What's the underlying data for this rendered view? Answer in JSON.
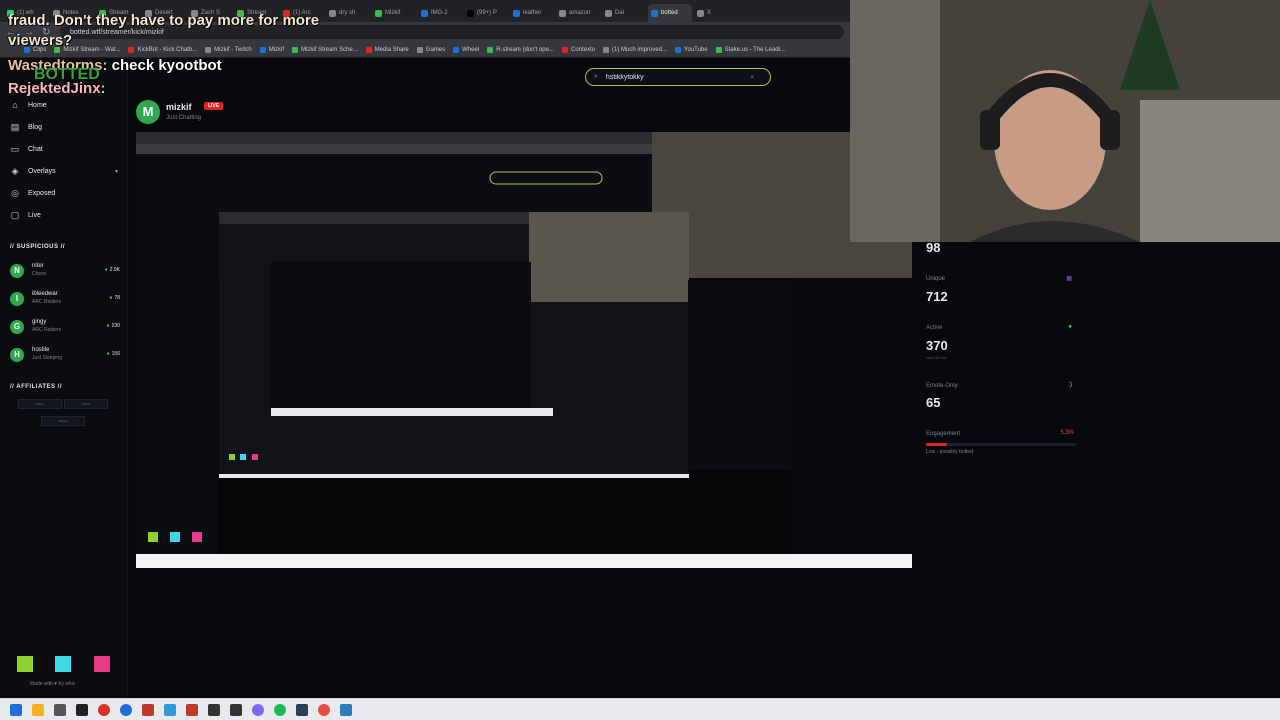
{
  "browser": {
    "tabs": [
      "(1) wh",
      "Notes",
      "Stream",
      "Desert",
      "Zach S",
      "Stream",
      "(1) Arc",
      "dry sh",
      "Mizkif",
      "IMG-2",
      "(99+) P",
      "leather",
      "amazon",
      "Dai",
      "botted",
      "X"
    ],
    "url": "botted.wtf/streamer/kick/mizkif",
    "bookmarks": [
      "Clips",
      "Mizkif Stream - Wat...",
      "KickBot - Kick Chatb...",
      "Mizkif - Twitch",
      "Mizkif",
      "Mizkif Stream Sche...",
      "Media Share",
      "Games",
      "Wheel",
      "R-stream (don't ope...",
      "Contexto",
      "(1) Much improved...",
      "YouTube",
      "Stake.us - The Leadi..."
    ]
  },
  "chat_overlay": [
    {
      "text": "fraud. Don't they have to pay more for more"
    },
    {
      "text": "viewers?"
    },
    {
      "user": "Wastedtorms:",
      "message": "check kyootbot"
    },
    {
      "user": "BOTTED"
    },
    {
      "user": "RejektedJinx:"
    }
  ],
  "search": {
    "value": "hstikkytokky"
  },
  "sidebar": {
    "items": [
      {
        "label": "Home",
        "icon": "home-icon"
      },
      {
        "label": "Blog",
        "icon": "blog-icon"
      },
      {
        "label": "Chat",
        "icon": "chat-icon"
      },
      {
        "label": "Overlays",
        "icon": "overlays-icon"
      },
      {
        "label": "Exposed",
        "icon": "exposed-icon"
      },
      {
        "label": "Live",
        "icon": "live-icon"
      }
    ],
    "suspicious_title": "// SUSPICIOUS //",
    "suspicious": [
      {
        "initial": "N",
        "name": "niter",
        "game": "Chess",
        "viewers": "2.9K"
      },
      {
        "initial": "I",
        "name": "ibleedwar",
        "game": "ARC Raiders",
        "viewers": "78"
      },
      {
        "initial": "G",
        "name": "gingy",
        "game": "ARC Raiders",
        "viewers": "230"
      },
      {
        "initial": "H",
        "name": "hostile",
        "game": "Just Sleeping",
        "viewers": "156"
      }
    ],
    "affiliates_title": "// AFFILIATES //",
    "affiliates": [
      "affiliate",
      "affiliate",
      "affiliate"
    ]
  },
  "channel": {
    "initial": "M",
    "name": "mizkif",
    "live_badge": "LIVE",
    "category": "Just Chatting"
  },
  "stats": {
    "top_value": "98",
    "unique_label": "Unique",
    "unique_value": "712",
    "active_label": "Active",
    "active_value": "370",
    "active_sub": "Last 30 min",
    "emote_label": "Emote-Only",
    "emote_value": "65",
    "engagement_label": "Engagement",
    "engagement_value": "5.3%",
    "engagement_fraction": 0.053,
    "engagement_note": "Low - possibly botted"
  },
  "footer": {
    "made_with": "Made with ♥ by whiz"
  },
  "colors": {
    "accent": "#a6c45f",
    "live": "#e02424",
    "avatar": "#2fa84f"
  },
  "swatches": [
    "#8ed12c",
    "#3fd8e8",
    "#e63a8a"
  ]
}
